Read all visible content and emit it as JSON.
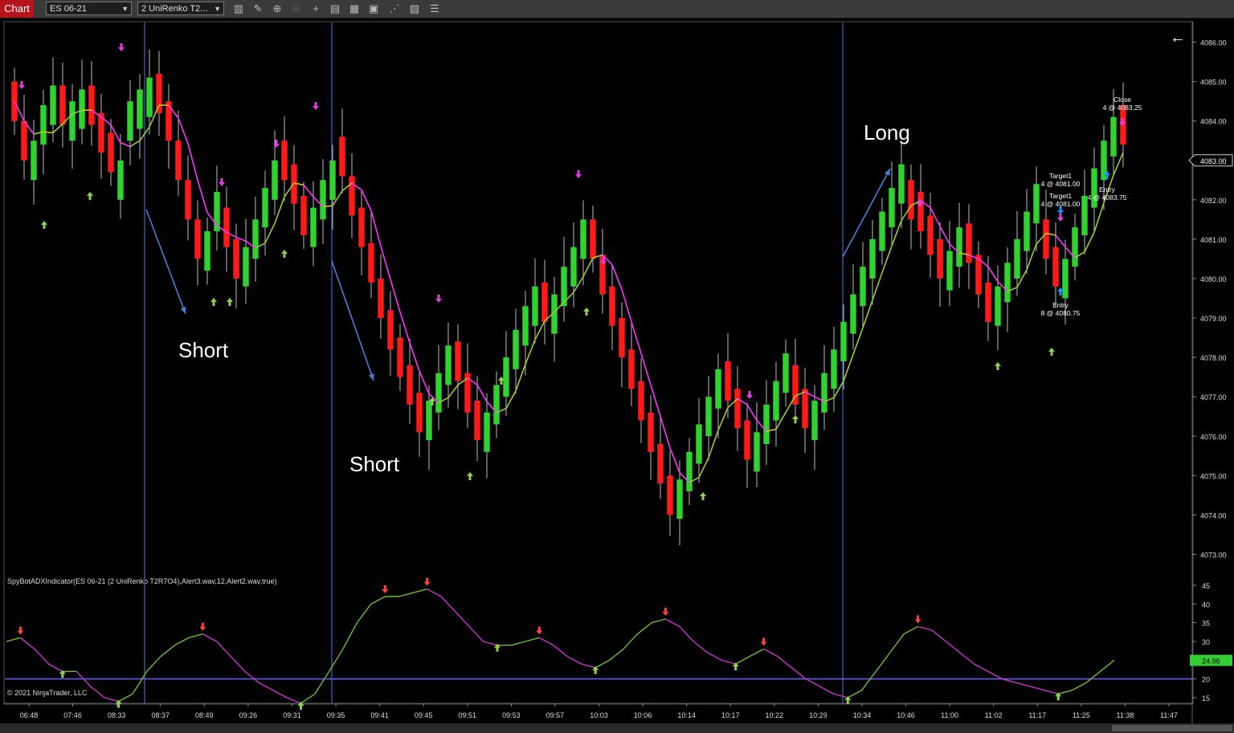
{
  "toolbar": {
    "chart_label": "Chart",
    "instrument": "ES 06-21",
    "bar_type": "2 UniRenko T2...",
    "icons": [
      "bars-icon",
      "draw-pencil-icon",
      "zoom-in-icon",
      "zoom-out-icon",
      "crosshair-icon",
      "properties-icon",
      "templates-icon",
      "data-box-icon",
      "indicators-icon",
      "strategies-icon",
      "more-icon"
    ]
  },
  "colors": {
    "background": "#000000",
    "up_bar": "#2fd22f",
    "down_bar": "#ff1a1a",
    "ma_up": "#9acd32",
    "ma_down": "#ff33ff",
    "ma_flat": "#e0c020",
    "separator": "#4a7fd8",
    "arrow_up": "#8fd14f",
    "arrow_down": "#e040e0",
    "adx_up": "#6fbf2f",
    "adx_down": "#cc33cc",
    "adx_level": "#6a5cff",
    "adx_value_badge": "#33cc33"
  },
  "chart_data": [
    {
      "type": "candlestick",
      "title": "",
      "ylim": [
        4072.5,
        4086.5
      ],
      "y_ticks": [
        "4086.00",
        "4085.00",
        "4084.00",
        "4083.00",
        "4082.00",
        "4081.00",
        "4080.00",
        "4079.00",
        "4078.00",
        "4077.00",
        "4076.00",
        "4075.00",
        "4074.00",
        "4073.00"
      ],
      "current_price_label": "4083.00",
      "x_tick_labels": [
        "06:48",
        "07:46",
        "08:33",
        "08:37",
        "08:49",
        "09:26",
        "09:31",
        "09:35",
        "09:41",
        "09:45",
        "09:51",
        "09:53",
        "09:57",
        "10:03",
        "10:06",
        "10:14",
        "10:17",
        "10:22",
        "10:29",
        "10:34",
        "10:46",
        "11:00",
        "11:02",
        "11:17",
        "11:25",
        "11:38",
        "11:47"
      ],
      "annotations": [
        "Short",
        "Short",
        "Long"
      ],
      "trade_labels": [
        "Close",
        "4 @ 4083.25",
        "Target1",
        "4 @ 4081.00",
        "Target1",
        "4 @ 4081.00",
        "Entry",
        "4 @ 4083.75",
        "Entry",
        "8 @ 4080.75"
      ],
      "close_path": [
        4084.0,
        4083.0,
        4083.5,
        4084.4,
        4084.9,
        4083.9,
        4084.5,
        4084.8,
        4083.9,
        4083.2,
        4082.7,
        4083.0,
        4084.5,
        4084.8,
        4085.1,
        4084.2,
        4083.5,
        4082.5,
        4081.5,
        4080.5,
        4081.2,
        4082.2,
        4080.8,
        4080.0,
        4080.8,
        4081.5,
        4082.3,
        4083.0,
        4082.5,
        4081.9,
        4081.1,
        4081.8,
        4082.5,
        4083.0,
        4082.6,
        4081.6,
        4080.8,
        4079.9,
        4079.0,
        4078.2,
        4077.5,
        4076.8,
        4076.1,
        4076.9,
        4077.6,
        4078.3,
        4077.4,
        4076.6,
        4075.9,
        4076.6,
        4077.3,
        4078.0,
        4078.7,
        4079.3,
        4079.8,
        4078.9,
        4079.6,
        4080.3,
        4080.8,
        4081.5,
        4080.5,
        4079.6,
        4078.8,
        4078.0,
        4077.2,
        4076.4,
        4075.6,
        4074.8,
        4074.0,
        4074.9,
        4075.6,
        4076.3,
        4077.0,
        4077.7,
        4076.9,
        4076.2,
        4075.4,
        4076.1,
        4076.8,
        4077.4,
        4078.1,
        4076.8,
        4076.2,
        4076.9,
        4077.6,
        4078.2,
        4078.9,
        4079.6,
        4080.3,
        4081.0,
        4081.7,
        4082.3,
        4082.9,
        4081.5,
        4081.2,
        4080.6,
        4080.0,
        4080.7,
        4081.3,
        4080.4,
        4079.6,
        4078.9,
        4079.8,
        4080.4,
        4081.0,
        4081.7,
        4082.4,
        4080.5,
        4079.8,
        4080.5,
        4081.3,
        4082.1,
        4082.8,
        4083.5,
        4084.1,
        4083.4
      ],
      "series": [
        {
          "name": "",
          "type": "moving_average"
        }
      ]
    },
    {
      "type": "line",
      "title": "SpyBotADXIndicator(ES 06-21 (2 UniRenko T2R7O4),Alert3.wav,12,Alert2.wav,true)",
      "ylim": [
        13.5,
        48
      ],
      "y_ticks": [
        "45",
        "40",
        "35",
        "30",
        "25",
        "20",
        "15"
      ],
      "level": 20,
      "current_value_label": "24.96",
      "series": [
        {
          "name": "",
          "values": [
            30,
            31,
            28,
            24,
            22,
            22,
            18,
            15,
            14,
            16,
            22,
            26,
            29,
            31,
            32,
            30,
            26,
            22,
            19,
            17,
            15,
            13.5,
            16,
            22,
            28,
            35,
            40,
            42,
            42,
            43,
            44,
            42,
            38,
            34,
            30,
            29,
            29,
            30,
            31,
            29,
            26,
            24,
            23,
            25,
            28,
            32,
            35,
            36,
            34,
            30,
            27,
            25,
            24,
            26,
            28,
            26,
            23,
            20,
            18,
            16,
            15,
            17,
            22,
            27,
            32,
            34,
            33,
            30,
            27,
            24,
            22,
            20,
            19,
            18,
            17,
            16,
            17,
            19,
            22,
            25
          ]
        }
      ]
    }
  ],
  "copyright": "© 2021 NinjaTrader, LLC",
  "back_arrow": "←"
}
